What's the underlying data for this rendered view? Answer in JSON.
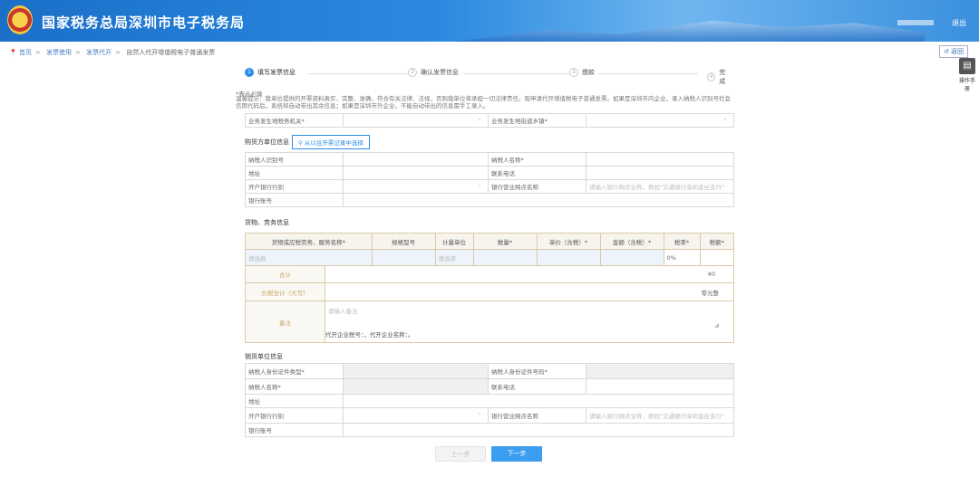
{
  "header": {
    "title": "国家税务总局深圳市电子税务局",
    "logout": "退出"
  },
  "breadcrumb": [
    "首页",
    "发票使用",
    "发票代开",
    "自然人代开增值税电子普通发票"
  ],
  "back_label": "返回",
  "guide_label": "操作手册",
  "steps": [
    "填写发票信息",
    "确认发票信息",
    "缴款",
    "完成"
  ],
  "required_note": "*表示必填",
  "notice": "温馨提示：我单位提供的开票资料真实、完整、准确，符合有关法律、法规，否则我单位将承担一切法律责任。现申请代开增值税电子普通发票。如果是深圳市内企业，录入纳税人识别号社会信用代码后，系统将自动带出其余信息；如果是深圳市外企业，不能自动带出的信息需手工录入。",
  "location": {
    "authority_label": "业务发生地税务机关*",
    "street_label": "业务发生地街道乡镇*"
  },
  "buyer": {
    "section": "购货方单位信息",
    "pick_button": "从以往开票记录中选择",
    "taxpayer_id": "纳税人识别号",
    "name": "纳税人名称*",
    "address": "地址",
    "phone": "联系电话",
    "bank": "开户银行行别",
    "branch": "银行营业网点名称",
    "branch_placeholder": "请输入银行网点全称，例如\"交通银行深圳金丝支行\"",
    "account": "银行账号"
  },
  "goods": {
    "section": "货物、劳务信息",
    "headers": [
      "货物或应税劳务、服务名称*",
      "规格型号",
      "计量单位",
      "数量*",
      "单价（含税）*",
      "金额（含税）*",
      "税率*",
      "税额*"
    ],
    "name_placeholder": "请选择",
    "unit_placeholder": "请选择",
    "tax_rate": "0%",
    "total_label": "合计",
    "total_value": "¥0",
    "sum_label": "价税合计（大写）",
    "sum_value": "零元整",
    "remark_label": "备注",
    "remark_placeholder": "请输入备注",
    "remark_text": "代开企业税号：，代开企业名称：。"
  },
  "seller": {
    "section": "销货单位信息",
    "id_type": "纳税人身份证件类型*",
    "id_no": "纳税人身份证件号码*",
    "name": "纳税人名称*",
    "phone": "联系电话",
    "address": "地址",
    "bank": "开户银行行别",
    "branch": "银行营业网点名称",
    "branch_placeholder": "请输入银行网点全称，例如\"交通银行深圳金丝支行\"",
    "account": "银行账号"
  },
  "buttons": {
    "prev": "上一步",
    "next": "下一步"
  }
}
